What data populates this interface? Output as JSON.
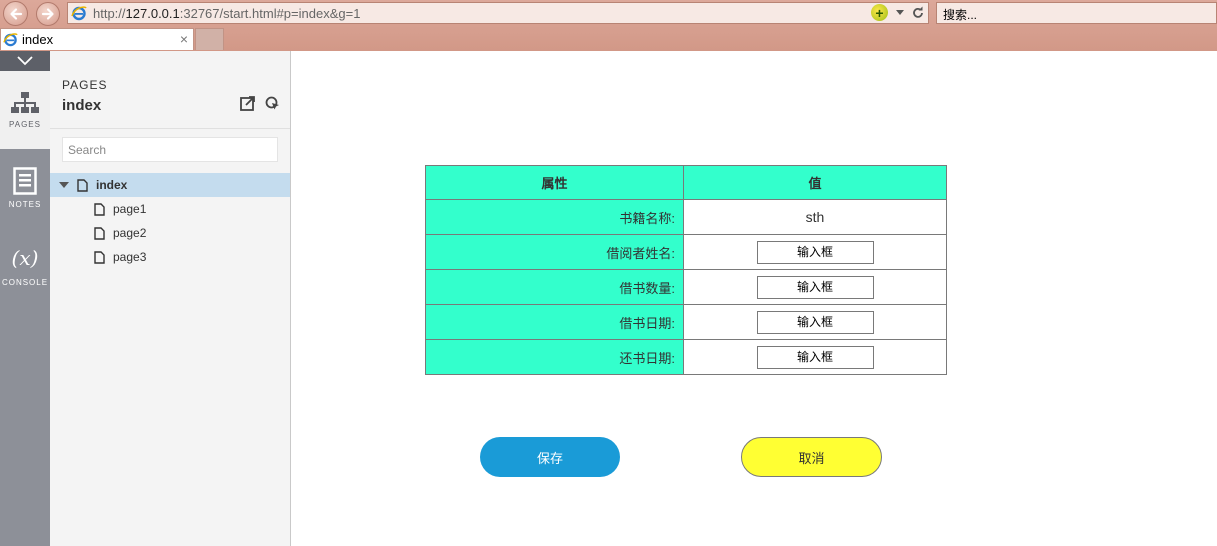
{
  "browser": {
    "address_prefix": "http://",
    "address_host": "127.0.0.1",
    "address_rest": ":32767/start.html#p=index&g=1",
    "search_placeholder": "搜索...",
    "tab_title": "index",
    "tab_close": "×"
  },
  "rail": {
    "items": [
      {
        "label": "PAGES",
        "icon": "sitemap-icon"
      },
      {
        "label": "NOTES",
        "icon": "notes-icon"
      },
      {
        "label": "CONSOLE",
        "icon": "variable-x-icon",
        "glyph": "(x)"
      }
    ]
  },
  "pages_panel": {
    "label": "PAGES",
    "current_page": "index",
    "search_placeholder": "Search",
    "tree": [
      {
        "label": "index",
        "selected": true
      },
      {
        "label": "page1"
      },
      {
        "label": "page2"
      },
      {
        "label": "page3"
      }
    ]
  },
  "form": {
    "headers": [
      "属性",
      "值"
    ],
    "rows": [
      {
        "label": "书籍名称:",
        "value": "sth",
        "kind": "text"
      },
      {
        "label": "借阅者姓名:",
        "value": "输入框",
        "kind": "input"
      },
      {
        "label": "借书数量:",
        "value": "输入框",
        "kind": "input"
      },
      {
        "label": "借书日期:",
        "value": "输入框",
        "kind": "input"
      },
      {
        "label": "还书日期:",
        "value": "输入框",
        "kind": "input"
      }
    ],
    "save_label": "保存",
    "cancel_label": "取消"
  },
  "colors": {
    "table_header": "#33ffcc",
    "save_button": "#1a9bd7",
    "cancel_button": "#ffff33"
  }
}
